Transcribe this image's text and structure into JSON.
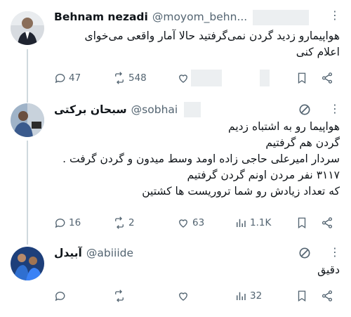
{
  "tweets": [
    {
      "name": "Behnam nezadi",
      "handle": "@moyom_behn...",
      "text_lines": [
        "هواپیمارو زدید گردن نمی‌گرفتید حالا آمار واقعی می‌خوای",
        "اعلام کنی"
      ],
      "replies": "47",
      "retweets": "548",
      "likes": "",
      "views": ""
    },
    {
      "name": "سبحان برکتی",
      "handle": "@sobhai",
      "text_lines": [
        "هواپیما رو به اشتباه زدیم",
        "گردن هم گرفتیم",
        "سردار امیرعلی حاجی زاده اومد وسط میدون و گردن گرفت .",
        "۳۱۱۷ نفر مردن اونم گردن گرفتیم",
        "که تعداد زیادش رو شما تروریست ها کشتین"
      ],
      "replies": "16",
      "retweets": "2",
      "likes": "63",
      "views": "1.1K"
    },
    {
      "name": "آبیدل",
      "handle": "@abiiide‌",
      "text_lines": [
        "دقیق"
      ],
      "replies": "",
      "retweets": "",
      "likes": "",
      "views": "32"
    }
  ],
  "icons": {
    "reply": "reply-icon",
    "retweet": "retweet-icon",
    "like": "heart-icon",
    "views": "views-icon",
    "bookmark": "bookmark-icon",
    "share": "share-icon",
    "more": "more-icon",
    "muted": "no-symbol-icon"
  },
  "colors": {
    "text": "#0f1419",
    "secondary": "#536471",
    "line": "#cfd9de"
  }
}
